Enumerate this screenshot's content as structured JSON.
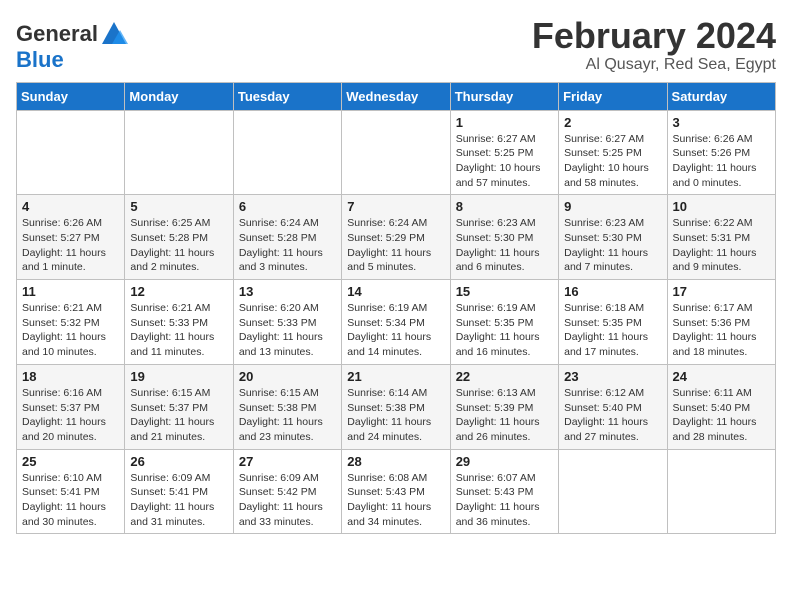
{
  "logo": {
    "line1": "General",
    "line2": "Blue"
  },
  "title": {
    "month": "February 2024",
    "location": "Al Qusayr, Red Sea, Egypt"
  },
  "weekdays": [
    "Sunday",
    "Monday",
    "Tuesday",
    "Wednesday",
    "Thursday",
    "Friday",
    "Saturday"
  ],
  "weeks": [
    [
      {
        "day": "",
        "info": ""
      },
      {
        "day": "",
        "info": ""
      },
      {
        "day": "",
        "info": ""
      },
      {
        "day": "",
        "info": ""
      },
      {
        "day": "1",
        "info": "Sunrise: 6:27 AM\nSunset: 5:25 PM\nDaylight: 10 hours and 57 minutes."
      },
      {
        "day": "2",
        "info": "Sunrise: 6:27 AM\nSunset: 5:25 PM\nDaylight: 10 hours and 58 minutes."
      },
      {
        "day": "3",
        "info": "Sunrise: 6:26 AM\nSunset: 5:26 PM\nDaylight: 11 hours and 0 minutes."
      }
    ],
    [
      {
        "day": "4",
        "info": "Sunrise: 6:26 AM\nSunset: 5:27 PM\nDaylight: 11 hours and 1 minute."
      },
      {
        "day": "5",
        "info": "Sunrise: 6:25 AM\nSunset: 5:28 PM\nDaylight: 11 hours and 2 minutes."
      },
      {
        "day": "6",
        "info": "Sunrise: 6:24 AM\nSunset: 5:28 PM\nDaylight: 11 hours and 3 minutes."
      },
      {
        "day": "7",
        "info": "Sunrise: 6:24 AM\nSunset: 5:29 PM\nDaylight: 11 hours and 5 minutes."
      },
      {
        "day": "8",
        "info": "Sunrise: 6:23 AM\nSunset: 5:30 PM\nDaylight: 11 hours and 6 minutes."
      },
      {
        "day": "9",
        "info": "Sunrise: 6:23 AM\nSunset: 5:30 PM\nDaylight: 11 hours and 7 minutes."
      },
      {
        "day": "10",
        "info": "Sunrise: 6:22 AM\nSunset: 5:31 PM\nDaylight: 11 hours and 9 minutes."
      }
    ],
    [
      {
        "day": "11",
        "info": "Sunrise: 6:21 AM\nSunset: 5:32 PM\nDaylight: 11 hours and 10 minutes."
      },
      {
        "day": "12",
        "info": "Sunrise: 6:21 AM\nSunset: 5:33 PM\nDaylight: 11 hours and 11 minutes."
      },
      {
        "day": "13",
        "info": "Sunrise: 6:20 AM\nSunset: 5:33 PM\nDaylight: 11 hours and 13 minutes."
      },
      {
        "day": "14",
        "info": "Sunrise: 6:19 AM\nSunset: 5:34 PM\nDaylight: 11 hours and 14 minutes."
      },
      {
        "day": "15",
        "info": "Sunrise: 6:19 AM\nSunset: 5:35 PM\nDaylight: 11 hours and 16 minutes."
      },
      {
        "day": "16",
        "info": "Sunrise: 6:18 AM\nSunset: 5:35 PM\nDaylight: 11 hours and 17 minutes."
      },
      {
        "day": "17",
        "info": "Sunrise: 6:17 AM\nSunset: 5:36 PM\nDaylight: 11 hours and 18 minutes."
      }
    ],
    [
      {
        "day": "18",
        "info": "Sunrise: 6:16 AM\nSunset: 5:37 PM\nDaylight: 11 hours and 20 minutes."
      },
      {
        "day": "19",
        "info": "Sunrise: 6:15 AM\nSunset: 5:37 PM\nDaylight: 11 hours and 21 minutes."
      },
      {
        "day": "20",
        "info": "Sunrise: 6:15 AM\nSunset: 5:38 PM\nDaylight: 11 hours and 23 minutes."
      },
      {
        "day": "21",
        "info": "Sunrise: 6:14 AM\nSunset: 5:38 PM\nDaylight: 11 hours and 24 minutes."
      },
      {
        "day": "22",
        "info": "Sunrise: 6:13 AM\nSunset: 5:39 PM\nDaylight: 11 hours and 26 minutes."
      },
      {
        "day": "23",
        "info": "Sunrise: 6:12 AM\nSunset: 5:40 PM\nDaylight: 11 hours and 27 minutes."
      },
      {
        "day": "24",
        "info": "Sunrise: 6:11 AM\nSunset: 5:40 PM\nDaylight: 11 hours and 28 minutes."
      }
    ],
    [
      {
        "day": "25",
        "info": "Sunrise: 6:10 AM\nSunset: 5:41 PM\nDaylight: 11 hours and 30 minutes."
      },
      {
        "day": "26",
        "info": "Sunrise: 6:09 AM\nSunset: 5:41 PM\nDaylight: 11 hours and 31 minutes."
      },
      {
        "day": "27",
        "info": "Sunrise: 6:09 AM\nSunset: 5:42 PM\nDaylight: 11 hours and 33 minutes."
      },
      {
        "day": "28",
        "info": "Sunrise: 6:08 AM\nSunset: 5:43 PM\nDaylight: 11 hours and 34 minutes."
      },
      {
        "day": "29",
        "info": "Sunrise: 6:07 AM\nSunset: 5:43 PM\nDaylight: 11 hours and 36 minutes."
      },
      {
        "day": "",
        "info": ""
      },
      {
        "day": "",
        "info": ""
      }
    ]
  ]
}
